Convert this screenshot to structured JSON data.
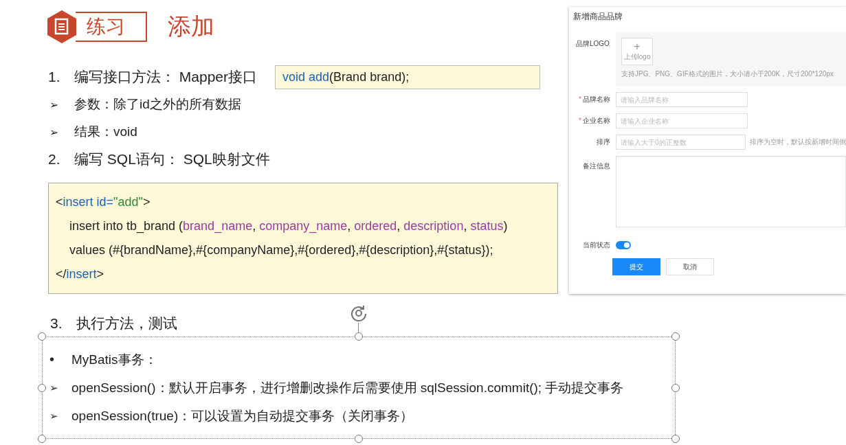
{
  "header": {
    "badge": "练习",
    "title": "添加"
  },
  "steps": [
    {
      "kind": "numbered",
      "marker": "1.",
      "text": "编写接口方法： Mapper接口",
      "code": [
        {
          "text": "void add",
          "kind": "keyword"
        },
        {
          "text": "(Brand brand);",
          "kind": "plain"
        }
      ]
    },
    {
      "kind": "arrow",
      "marker": "➢",
      "text": "参数：除了id之外的所有数据"
    },
    {
      "kind": "arrow",
      "marker": "➢",
      "text": "结果：void"
    },
    {
      "kind": "numbered",
      "marker": "2.",
      "text": "编写 SQL语句： SQL映射文件"
    }
  ],
  "code_block": [
    {
      "indent": false,
      "segments": [
        {
          "text": "<",
          "kind": "plain"
        },
        {
          "text": "insert id=",
          "kind": "keyword"
        },
        {
          "text": "\"add\"",
          "kind": "string"
        },
        {
          "text": ">",
          "kind": "plain"
        }
      ]
    },
    {
      "indent": true,
      "segments": [
        {
          "text": "insert into tb_brand (",
          "kind": "plain"
        },
        {
          "text": "brand_name",
          "kind": "column"
        },
        {
          "text": ", ",
          "kind": "plain"
        },
        {
          "text": "company_name",
          "kind": "column"
        },
        {
          "text": ", ",
          "kind": "plain"
        },
        {
          "text": "ordered",
          "kind": "column"
        },
        {
          "text": ", ",
          "kind": "plain"
        },
        {
          "text": "description",
          "kind": "column"
        },
        {
          "text": ", ",
          "kind": "plain"
        },
        {
          "text": "status",
          "kind": "column"
        },
        {
          "text": ")",
          "kind": "plain"
        }
      ]
    },
    {
      "indent": true,
      "segments": [
        {
          "text": "values (#{brandName},#{companyName},#{ordered},#{description},#{status});",
          "kind": "plain"
        }
      ]
    },
    {
      "indent": false,
      "segments": [
        {
          "text": "</",
          "kind": "plain"
        },
        {
          "text": "insert",
          "kind": "keyword"
        },
        {
          "text": ">",
          "kind": "plain"
        }
      ]
    }
  ],
  "step3": {
    "marker": "3.",
    "text": "执行方法，测试"
  },
  "selected_box": {
    "selected": true,
    "items": [
      {
        "kind": "dot",
        "marker": "•",
        "text": "MyBatis事务："
      },
      {
        "kind": "arrow",
        "marker": "➢",
        "text": "openSession()：默认开启事务，进行增删改操作后需要使用 sqlSession.commit(); 手动提交事务"
      },
      {
        "kind": "arrow",
        "marker": "➢",
        "text": "openSession(true)：可以设置为自动提交事务（关闭事务）"
      }
    ]
  },
  "form": {
    "title": "新增商品品牌",
    "fields": [
      {
        "kind": "upload",
        "label": "品牌LOGO",
        "button": "+",
        "button_label": "上传logo",
        "hint": "支持JPG、PNG、GIF格式的图片，大小请小于200K，尺寸200*120px"
      },
      {
        "kind": "input",
        "required_mark": "*",
        "label": "品牌名称",
        "placeholder": "请输入品牌名称"
      },
      {
        "kind": "input",
        "required_mark": "*",
        "label": "企业名称",
        "placeholder": "请输入企业名称"
      },
      {
        "kind": "input",
        "label": "排序",
        "placeholder": "请输入大于0的正整数",
        "hint": "排序为空时，默认按新增时间倒"
      },
      {
        "kind": "textarea",
        "label": "备注信息"
      },
      {
        "kind": "switch",
        "label": "当前状态",
        "on": true
      }
    ],
    "buttons": [
      {
        "kind": "primary",
        "label": "提交"
      },
      {
        "kind": "default",
        "label": "取消"
      }
    ]
  }
}
